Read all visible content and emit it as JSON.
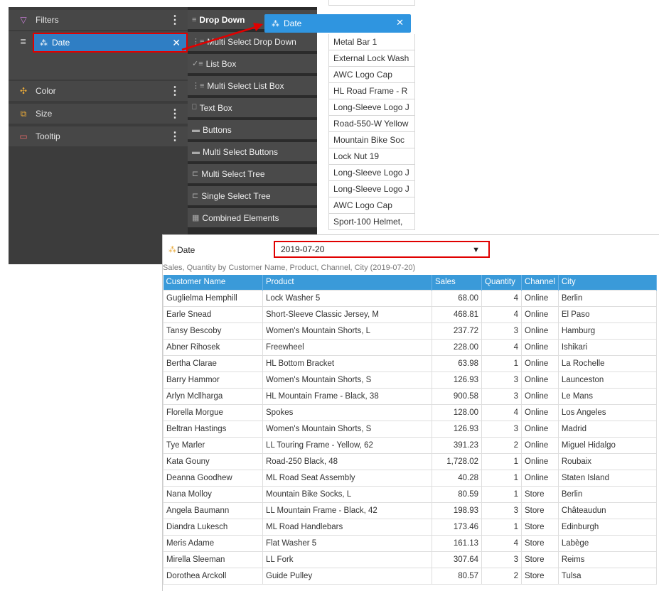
{
  "left_panel": {
    "filters_label": "Filters",
    "date_chip_label": "Date",
    "color_label": "Color",
    "size_label": "Size",
    "tooltip_label": "Tooltip"
  },
  "palette": {
    "items": [
      "Drop Down",
      "Multi Select Drop Down",
      "List Box",
      "Multi Select List Box",
      "Text Box",
      "Buttons",
      "Multi Select Buttons",
      "Multi Select Tree",
      "Single Select Tree",
      "Combined Elements"
    ]
  },
  "product_list": [
    "Metal Bar 1",
    "External Lock Wash",
    "AWC Logo Cap",
    "HL Road Frame - R",
    "Long-Sleeve Logo J",
    "Road-550-W Yellow",
    "Mountain Bike Soc",
    "Lock Nut 19",
    "Long-Sleeve Logo J",
    "Long-Sleeve Logo J",
    "AWC Logo Cap",
    "Sport-100 Helmet,"
  ],
  "drag_chip_label": "Date",
  "dashboard": {
    "date_label": "Date",
    "date_value": "2019-07-20",
    "caption": "Sales, Quantity by Customer Name, Product, Channel, City (2019-07-20)",
    "columns": [
      "Customer Name",
      "Product",
      "Sales",
      "Quantity",
      "Channel",
      "City"
    ],
    "rows": [
      [
        "Guglielma Hemphill",
        "Lock Washer 5",
        "68.00",
        "4",
        "Online",
        "Berlin"
      ],
      [
        "Earle Snead",
        "Short-Sleeve Classic Jersey, M",
        "468.81",
        "4",
        "Online",
        "El Paso"
      ],
      [
        "Tansy Bescoby",
        "Women's Mountain Shorts, L",
        "237.72",
        "3",
        "Online",
        "Hamburg"
      ],
      [
        "Abner Rihosek",
        "Freewheel",
        "228.00",
        "4",
        "Online",
        "Ishikari"
      ],
      [
        "Bertha Clarae",
        "HL Bottom Bracket",
        "63.98",
        "1",
        "Online",
        "La Rochelle"
      ],
      [
        "Barry Hammor",
        "Women's Mountain Shorts, S",
        "126.93",
        "3",
        "Online",
        "Launceston"
      ],
      [
        "Arlyn Mcllharga",
        "HL Mountain Frame - Black, 38",
        "900.58",
        "3",
        "Online",
        "Le Mans"
      ],
      [
        "Florella Morgue",
        "Spokes",
        "128.00",
        "4",
        "Online",
        "Los Angeles"
      ],
      [
        "Beltran Hastings",
        "Women's Mountain Shorts, S",
        "126.93",
        "3",
        "Online",
        "Madrid"
      ],
      [
        "Tye Marler",
        "LL Touring Frame - Yellow, 62",
        "391.23",
        "2",
        "Online",
        "Miguel Hidalgo"
      ],
      [
        "Kata Gouny",
        "Road-250 Black, 48",
        "1,728.02",
        "1",
        "Online",
        "Roubaix"
      ],
      [
        "Deanna Goodhew",
        "ML Road Seat Assembly",
        "40.28",
        "1",
        "Online",
        "Staten Island"
      ],
      [
        "Nana Molloy",
        "Mountain Bike Socks, L",
        "80.59",
        "1",
        "Store",
        "Berlin"
      ],
      [
        "Angela Baumann",
        "LL Mountain Frame - Black, 42",
        "198.93",
        "3",
        "Store",
        "Châteaudun"
      ],
      [
        "Diandra Lukesch",
        "ML Road Handlebars",
        "173.46",
        "1",
        "Store",
        "Edinburgh"
      ],
      [
        "Meris Adame",
        "Flat Washer 5",
        "161.13",
        "4",
        "Store",
        "Labège"
      ],
      [
        "Mirella Sleeman",
        "LL Fork",
        "307.64",
        "3",
        "Store",
        "Reims"
      ],
      [
        "Dorothea Arckoll",
        "Guide Pulley",
        "80.57",
        "2",
        "Store",
        "Tulsa"
      ]
    ]
  }
}
